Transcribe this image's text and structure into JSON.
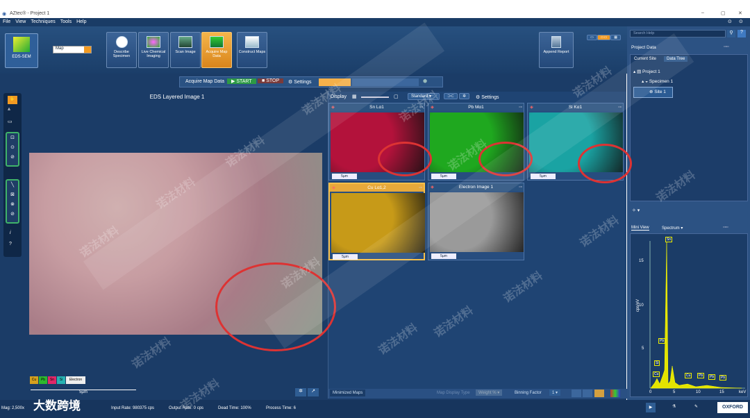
{
  "window": {
    "title": "AZtec® - Project 1"
  },
  "menu": [
    "File",
    "View",
    "Techniques",
    "Tools",
    "Help"
  ],
  "ribbon": {
    "mode_label": "EDS-SEM",
    "dropdown_value": "Map",
    "steps": [
      {
        "label": "Describe Specimen"
      },
      {
        "label": "Live Chemical Imaging"
      },
      {
        "label": "Scan Image"
      },
      {
        "label": "Acquire Map Data",
        "active": true
      },
      {
        "label": "Construct Maps"
      }
    ],
    "append_report": "Append Report"
  },
  "acq_toolbar": {
    "title": "Acquire Map Data",
    "start": "START",
    "stop": "STOP",
    "settings": "Settings"
  },
  "eds": {
    "title": "EDS Layered Image 1",
    "legend": [
      "Cu",
      "Pb",
      "Sn",
      "Si",
      "Electron"
    ],
    "scalebar": "5µm"
  },
  "display_bar": {
    "label": "Display",
    "mode": "Standard",
    "settings": "Settings"
  },
  "maps": [
    {
      "name": "Sn Lα1",
      "color": "#b3123b",
      "scale": "5µm"
    },
    {
      "name": "Pb Mα1",
      "color": "#1fa81f",
      "scale": "5µm"
    },
    {
      "name": "Si Kα1",
      "color": "#1aa3a3",
      "scale": "5µm"
    },
    {
      "name": "Cu Lα1,2",
      "color": "#c79a18",
      "scale": "5µm"
    },
    {
      "name": "Electron Image 1",
      "color": "#9a9a9a",
      "scale": "5µm"
    }
  ],
  "maps_footer": {
    "tab": "Minimized Maps",
    "display_type_label": "Map Display Type",
    "display_type_value": "Weight %",
    "binning_label": "Binning Factor",
    "binning_value": "1"
  },
  "right": {
    "search_placeholder": "Search Help",
    "project_data": "Project Data",
    "tabs": [
      "Current Site",
      "Data Tree"
    ],
    "tree": [
      "Project 1",
      "Specimen 1",
      "Site 1"
    ],
    "spectrum_tabs": [
      "Mini View",
      "Spectrum"
    ],
    "y_axis_label": "cps/eV",
    "y_ticks": [
      "15",
      "10",
      "5"
    ],
    "x_ticks": [
      "0",
      "5",
      "10",
      "15"
    ],
    "x_unit": "keV",
    "peaks": [
      "Sn",
      "Pb",
      "Si",
      "Cu",
      "Cu",
      "Pb",
      "Pb",
      "Pb"
    ]
  },
  "status": {
    "mag": "Mag: 2,500x",
    "input_rate": "Input Rate: 980375 cps",
    "output_rate": "Output Rate: 0 cps",
    "dead_time": "Dead Time: 100%",
    "process_time": "Process Time: 6",
    "logo": "OXFORD",
    "watermark_brand": "大数跨境"
  },
  "watermarks": [
    "诺法材料"
  ]
}
